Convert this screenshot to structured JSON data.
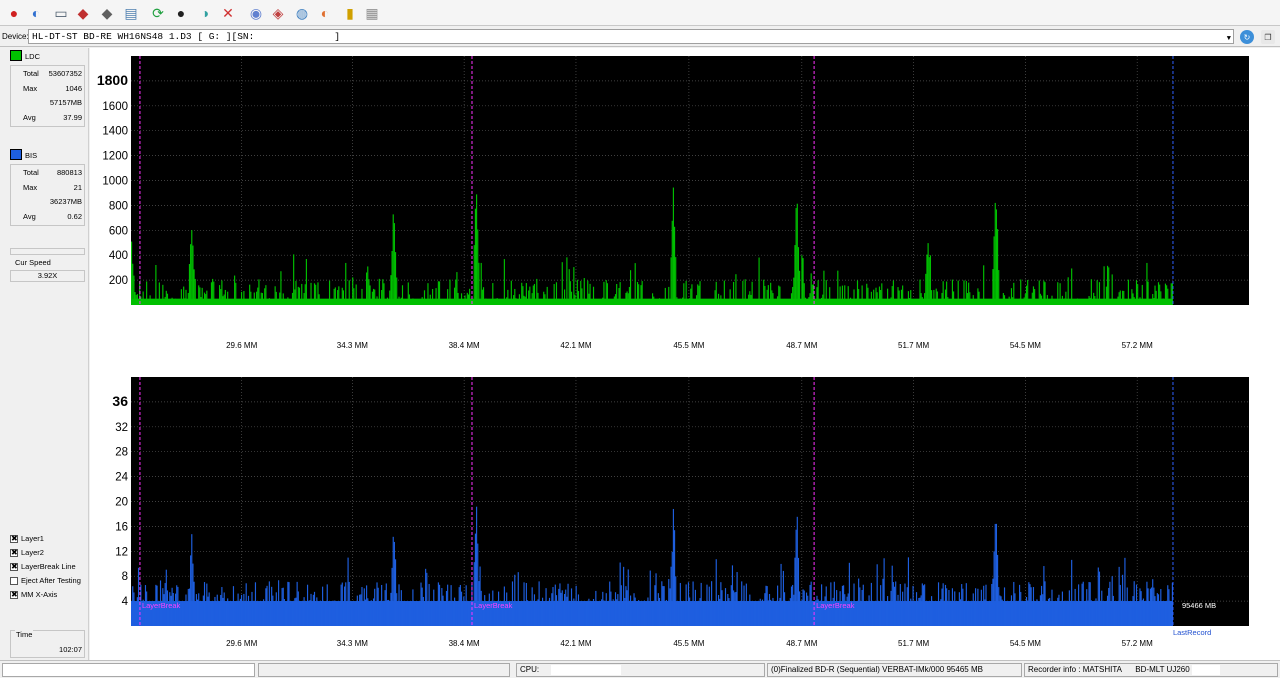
{
  "device": {
    "label": "Device:",
    "value": "HL-DT-ST BD-RE  WH16NS48  1.D3 [ G: ][SN:",
    "sn_close": "]"
  },
  "ldc": {
    "label": "LDC",
    "color": "#00c000",
    "stats": [
      {
        "key": "Total",
        "value": "53607352"
      },
      {
        "key": "Max",
        "value": "1046"
      },
      {
        "key": "",
        "value": "57157MB"
      },
      {
        "key": "Avg",
        "value": "37.99"
      }
    ]
  },
  "bis": {
    "label": "BIS",
    "color": "#1e5fe0",
    "stats": [
      {
        "key": "Total",
        "value": "880813"
      },
      {
        "key": "Max",
        "value": "21"
      },
      {
        "key": "",
        "value": "36237MB"
      },
      {
        "key": "Avg",
        "value": "0.62"
      }
    ]
  },
  "speed": {
    "label": "Cur Speed",
    "value": "3.92X"
  },
  "options": [
    {
      "label": "Layer1",
      "checked": true
    },
    {
      "label": "Layer2",
      "checked": true
    },
    {
      "label": "LayerBreak Line",
      "checked": true
    },
    {
      "label": "Eject After Testing",
      "checked": false
    },
    {
      "label": "MM X-Axis",
      "checked": true
    }
  ],
  "time": {
    "label": "Time",
    "value": "102:07"
  },
  "status": {
    "cpu_label": "CPU:",
    "disc_info": "(0)Finalized  BD-R (Sequential)  VERBAT-IMk/000   95465 MB",
    "recorder_label": "Recorder info : MATSHITA",
    "recorder_model": "BD-MLT UJ260"
  },
  "chart_data": [
    {
      "type": "bar",
      "title": "",
      "series": [
        {
          "name": "LDC",
          "color": "#00c000"
        }
      ],
      "x_ticks": [
        "29.6 MM",
        "34.3 MM",
        "38.4 MM",
        "42.1 MM",
        "45.5 MM",
        "48.7 MM",
        "51.7 MM",
        "54.5 MM",
        "57.2 MM"
      ],
      "y_ticks": [
        "1800",
        "1600",
        "1400",
        "1200",
        "1000",
        "800",
        "600",
        "400",
        "200"
      ],
      "ylim": [
        0,
        2000
      ],
      "baseline": 50,
      "peaks": [
        {
          "x": 0.0,
          "y": 550
        },
        {
          "x": 0.062,
          "y": 750
        },
        {
          "x": 0.27,
          "y": 900
        },
        {
          "x": 0.355,
          "y": 1000
        },
        {
          "x": 0.558,
          "y": 1040
        },
        {
          "x": 0.685,
          "y": 950
        },
        {
          "x": 0.82,
          "y": 620
        },
        {
          "x": 0.89,
          "y": 1040
        }
      ],
      "layer_breaks": [
        "LayerBreak",
        "LayerBreak",
        "LayerBreak"
      ],
      "grid": true
    },
    {
      "type": "bar",
      "title": "",
      "series": [
        {
          "name": "BIS",
          "color": "#1e5fe0"
        }
      ],
      "x_ticks": [
        "29.6 MM",
        "34.3 MM",
        "38.4 MM",
        "42.1 MM",
        "45.5 MM",
        "48.7 MM",
        "51.7 MM",
        "54.5 MM",
        "57.2 MM"
      ],
      "y_ticks": [
        "36",
        "32",
        "28",
        "24",
        "20",
        "16",
        "12",
        "8",
        "4"
      ],
      "ylim": [
        0,
        40
      ],
      "baseline": 4,
      "peaks": [
        {
          "x": 0.062,
          "y": 16
        },
        {
          "x": 0.27,
          "y": 19
        },
        {
          "x": 0.355,
          "y": 21
        },
        {
          "x": 0.558,
          "y": 21
        },
        {
          "x": 0.685,
          "y": 20
        },
        {
          "x": 0.89,
          "y": 21
        }
      ],
      "end_label": "95466 MB",
      "last_record_label": "LastRecord",
      "grid": true
    }
  ]
}
